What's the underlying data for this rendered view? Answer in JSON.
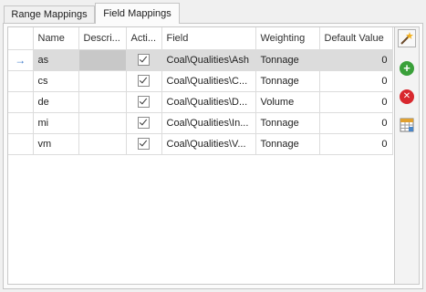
{
  "tabs": [
    {
      "label": "Range Mappings",
      "active": false
    },
    {
      "label": "Field Mappings",
      "active": true
    }
  ],
  "columns": [
    "Name",
    "Descri...",
    "Acti...",
    "Field",
    "Weighting",
    "Default Value"
  ],
  "rows": [
    {
      "name": "as",
      "description": "",
      "active": true,
      "field": "Coal\\Qualities\\Ash",
      "weighting": "Tonnage",
      "default_value": "0",
      "selected": true
    },
    {
      "name": "cs",
      "description": "",
      "active": true,
      "field": "Coal\\Qualities\\C...",
      "weighting": "Tonnage",
      "default_value": "0",
      "selected": false
    },
    {
      "name": "de",
      "description": "",
      "active": true,
      "field": "Coal\\Qualities\\D...",
      "weighting": "Volume",
      "default_value": "0",
      "selected": false
    },
    {
      "name": "mi",
      "description": "",
      "active": true,
      "field": "Coal\\Qualities\\In...",
      "weighting": "Tonnage",
      "default_value": "0",
      "selected": false
    },
    {
      "name": "vm",
      "description": "",
      "active": true,
      "field": "Coal\\Qualities\\V...",
      "weighting": "Tonnage",
      "default_value": "0",
      "selected": false
    }
  ],
  "toolbar": {
    "buttons": [
      {
        "name": "wizard-icon",
        "glyph": "magic-wand"
      },
      {
        "name": "add-icon",
        "glyph": "+"
      },
      {
        "name": "delete-icon",
        "glyph": "✕"
      },
      {
        "name": "table-icon",
        "glyph": "table"
      }
    ]
  },
  "colors": {
    "selected_row": "#dcdcdc",
    "add": "#3aa03a",
    "delete": "#d8282e",
    "row_indicator": "#3a78c8"
  }
}
